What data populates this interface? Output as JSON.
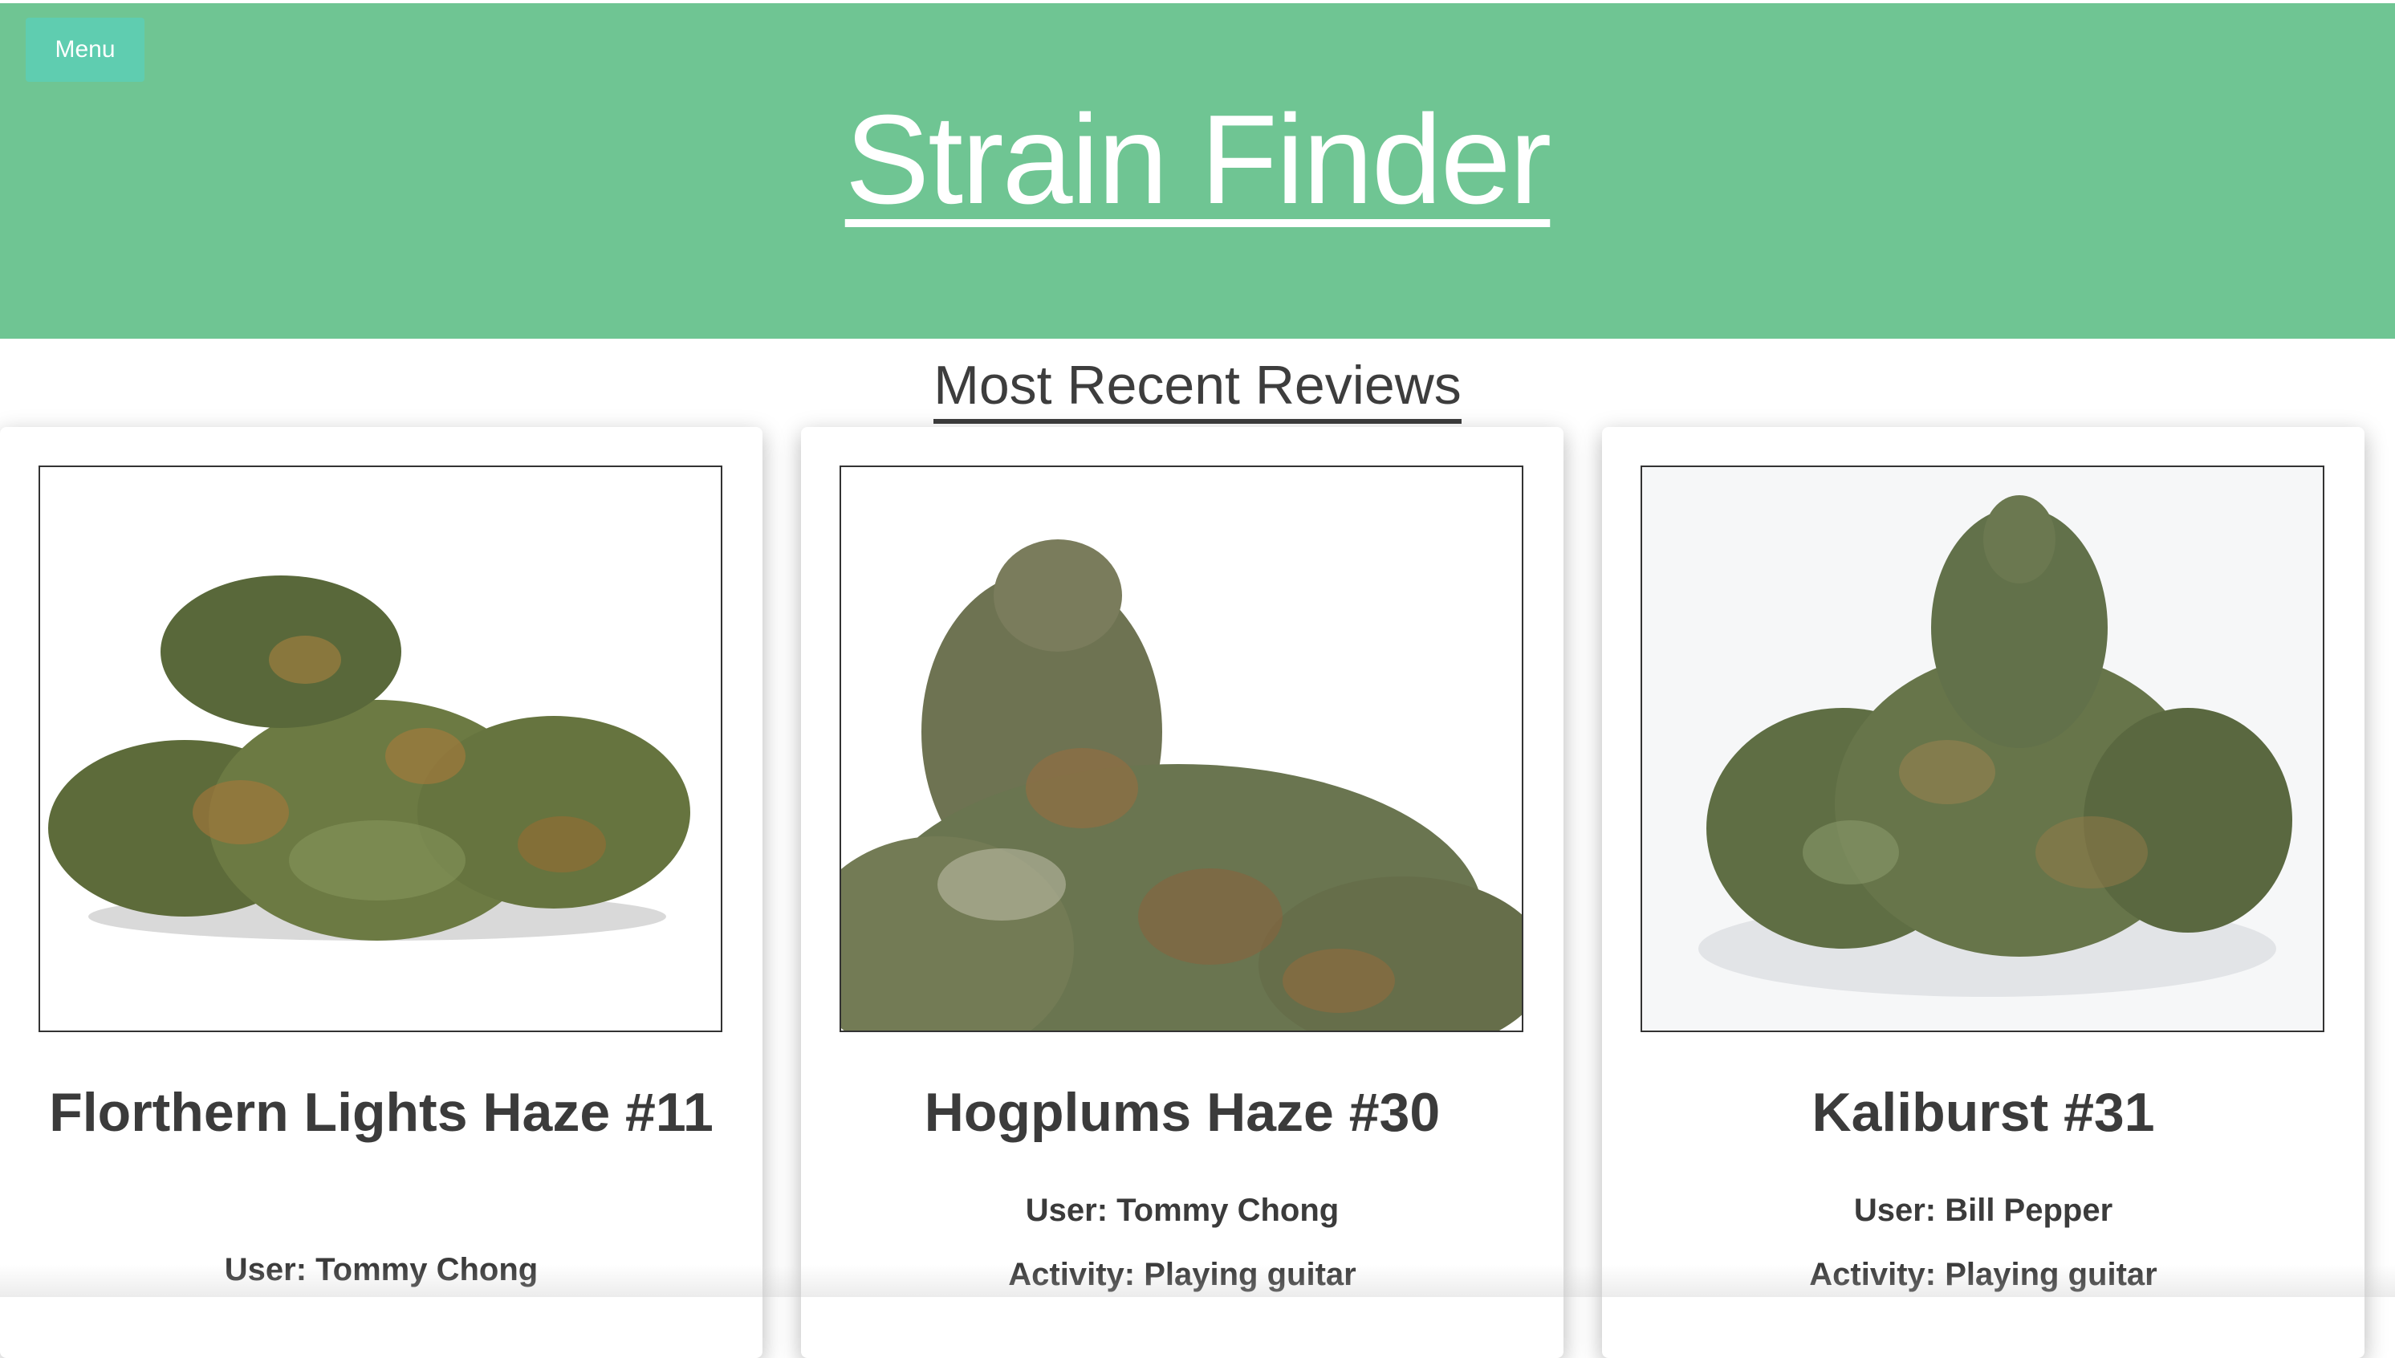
{
  "header": {
    "menu_label": "Menu",
    "title": "Strain Finder",
    "background": "#6fc593"
  },
  "section": {
    "title": "Most Recent Reviews"
  },
  "reviews": [
    {
      "name": "Florthern Lights Haze #11",
      "user": "User: Tommy Chong",
      "image": "cannabis-bud-photo"
    },
    {
      "name": "Hogplums Haze #30",
      "user": "User: Tommy Chong",
      "activity": "Activity: Playing guitar",
      "image": "cannabis-bud-photo"
    },
    {
      "name": "Kaliburst #31",
      "user": "User: Bill Pepper",
      "activity": "Activity: Playing guitar",
      "image": "cannabis-bud-photo"
    }
  ]
}
